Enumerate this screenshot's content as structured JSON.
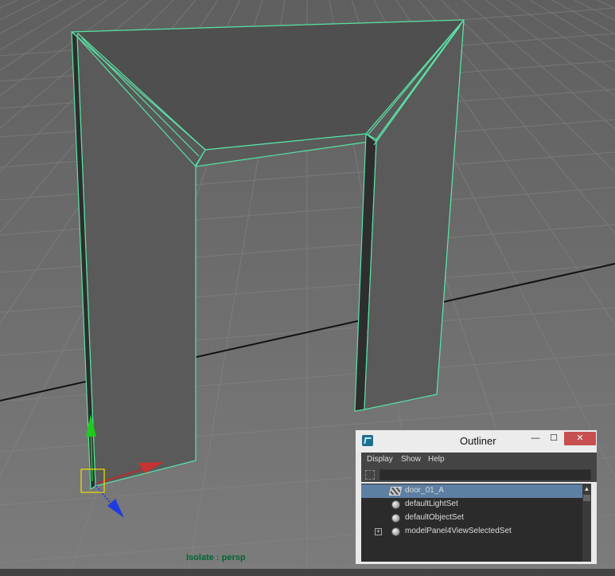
{
  "viewport": {
    "status_label": "Isolate : persp",
    "object_name": "door_01_A"
  },
  "outliner": {
    "title": "Outliner",
    "window_buttons": {
      "minimize": "—",
      "maximize": "☐",
      "close": "✕"
    },
    "menu": [
      "Display",
      "Show",
      "Help"
    ],
    "filter_value": "",
    "items": [
      {
        "label": "door_01_A",
        "icon": "mesh-icon",
        "selected": true,
        "expandable": false
      },
      {
        "label": "defaultLightSet",
        "icon": "set-icon",
        "selected": false,
        "expandable": false
      },
      {
        "label": "defaultObjectSet",
        "icon": "set-icon",
        "selected": false,
        "expandable": false
      },
      {
        "label": "modelPanel4ViewSelectedSet",
        "icon": "set-icon",
        "selected": false,
        "expandable": true
      }
    ],
    "expand_glyph": "+",
    "scroll_up_glyph": "▲"
  },
  "colors": {
    "viewport_bg": "#6b6b6b",
    "grid": "#7f7f7f",
    "selection_wire": "#58e3a5",
    "selected_row": "#5d7fa3"
  }
}
